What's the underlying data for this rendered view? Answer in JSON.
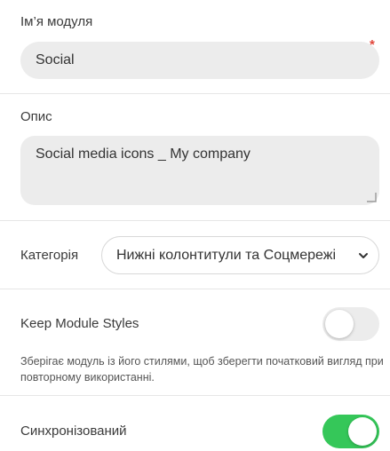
{
  "module_name": {
    "label": "Ім’я модуля",
    "value": "Social",
    "required_mark": "*"
  },
  "description": {
    "label": "Опис",
    "value": "Social media icons _ My company"
  },
  "category": {
    "label": "Категорія",
    "selected": "Нижні колонтитули та Соцмережі"
  },
  "keep_styles": {
    "label": "Keep Module Styles",
    "enabled": false,
    "help": "Зберігає модуль із його стилями, щоб зберегти початковий вигляд при повторному використанні."
  },
  "synced": {
    "label": "Синхронізований",
    "enabled": true
  },
  "colors": {
    "toggle_on": "#35c759",
    "toggle_off": "#ececec",
    "required": "#e0463b"
  },
  "icons": {
    "select_arrow": "chevron-down-icon",
    "resize": "resize-handle-icon"
  }
}
